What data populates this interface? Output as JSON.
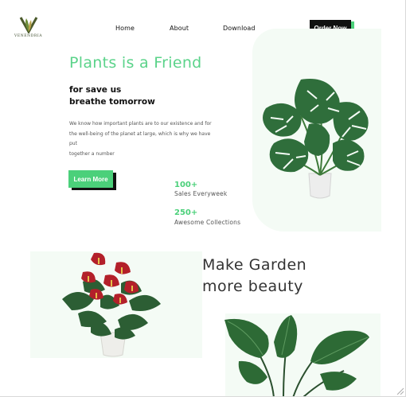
{
  "brand": {
    "logo_text": "VENENDRIA"
  },
  "nav": {
    "items": [
      "Home",
      "About",
      "Download"
    ],
    "cta": "Order Now"
  },
  "hero": {
    "title": "Plants is a Friend",
    "subtitle_line1": "for save us",
    "subtitle_line2": "breathe tomorrow",
    "desc_line1": "We know how important plants are to our existence and for",
    "desc_line2": "the well-being of the planet at large, which is why we have",
    "desc_line3": "put",
    "desc_line4": "together a number",
    "button": "Learn More"
  },
  "stats": [
    {
      "value": "100+",
      "label": "Sales Everyweek"
    },
    {
      "value": "250+",
      "label": "Awesome Collections"
    }
  ],
  "section2": {
    "title_line1": "Make Garden",
    "title_line2": "more beauty"
  },
  "colors": {
    "accent": "#4bd07a",
    "title_green": "#5bd38a",
    "dark": "#111111",
    "leaf": "#2e6b3a"
  },
  "icons": {
    "logo": "plant-logo-icon",
    "resize": "resize-grip-icon"
  }
}
